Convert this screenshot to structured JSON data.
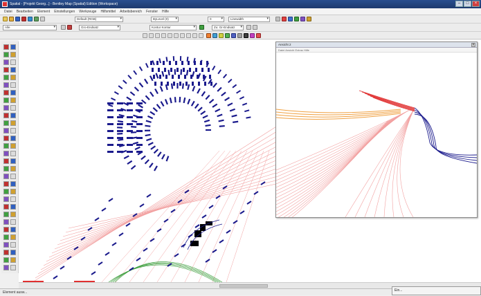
{
  "window": {
    "title": "Spatial - [Projekt Georg...] - Bentley Map (Spatial) Edition (Workspace)"
  },
  "menu": [
    "Datei",
    "Bearbeiten",
    "Element",
    "Einstellungen",
    "Werkzeuge",
    "Hilfsmittel",
    "Arbeitsbereich",
    "Fenster",
    "Hilfe"
  ],
  "toolbar": {
    "level_combo": "Default (RGB)",
    "style_combo": "ByLevel (0)",
    "weight_combo": "0",
    "view_combo": "Linewidth",
    "attr_combo": "Alle",
    "model_combo": "Gro-Endsatz",
    "color_combo": "Kontur Kontur",
    "zoom_label": "Zu: Gr-Endsatz"
  },
  "inset": {
    "title": "Ansicht 2",
    "menu": "Datei  Ansicht  Extras  Hilfe"
  },
  "status": {
    "text": "Element ausw..."
  },
  "popup": {
    "text": "Ein..."
  },
  "colors": {
    "blue": "#1a1a8c",
    "red": "#e03030",
    "pink": "#f2a0a0",
    "orange": "#f0a040",
    "green": "#40a040"
  }
}
